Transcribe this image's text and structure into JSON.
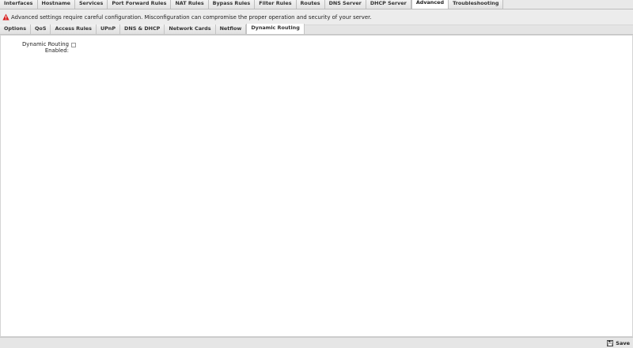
{
  "top_tabs": [
    {
      "label": "Interfaces",
      "active": false
    },
    {
      "label": "Hostname",
      "active": false
    },
    {
      "label": "Services",
      "active": false
    },
    {
      "label": "Port Forward Rules",
      "active": false
    },
    {
      "label": "NAT Rules",
      "active": false
    },
    {
      "label": "Bypass Rules",
      "active": false
    },
    {
      "label": "Filter Rules",
      "active": false
    },
    {
      "label": "Routes",
      "active": false
    },
    {
      "label": "DNS Server",
      "active": false
    },
    {
      "label": "DHCP Server",
      "active": false
    },
    {
      "label": "Advanced",
      "active": true
    },
    {
      "label": "Troubleshooting",
      "active": false
    }
  ],
  "warning": {
    "icon": "warning-triangle-icon",
    "color": "#d62020",
    "text": "Advanced settings require careful configuration. Misconfiguration can compromise the proper operation and security of your server."
  },
  "sub_tabs": [
    {
      "label": "Options",
      "active": false
    },
    {
      "label": "QoS",
      "active": false
    },
    {
      "label": "Access Rules",
      "active": false
    },
    {
      "label": "UPnP",
      "active": false
    },
    {
      "label": "DNS & DHCP",
      "active": false
    },
    {
      "label": "Network Cards",
      "active": false
    },
    {
      "label": "Netflow",
      "active": false
    },
    {
      "label": "Dynamic Routing",
      "active": true
    }
  ],
  "form": {
    "dynamic_routing_label": "Dynamic Routing Enabled:",
    "dynamic_routing_checked": false
  },
  "footer": {
    "save_label": "Save",
    "save_icon": "floppy-disk-icon"
  }
}
